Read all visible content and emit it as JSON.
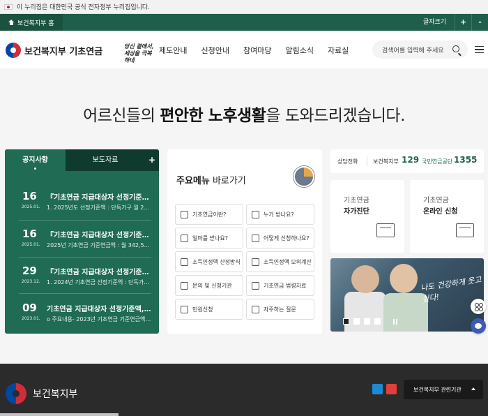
{
  "gov_banner": {
    "text": "이 누리집은 대한민국 공식 전자정부 누리집입니다."
  },
  "util": {
    "home_label": "보건복지부 홈",
    "fontsize_label": "글자크기",
    "plus": "+",
    "minus": "-"
  },
  "header": {
    "logo_text": "보건복지부 기초연금",
    "slogan": "당신 곁에서, 세상을 극복하네",
    "nav": [
      "제도안내",
      "신청안내",
      "참여마당",
      "알림소식",
      "자료실"
    ],
    "search_placeholder": "검색어를 입력해 주세요"
  },
  "hero": {
    "title_pre": "어르신들의 ",
    "title_bold": "편안한 노후생활",
    "title_post": "을 도와드리겠습니다."
  },
  "board": {
    "tabs": [
      "공지사항",
      "보도자료",
      "+"
    ],
    "notices": [
      {
        "day": "16",
        "ym": "2025.01.",
        "title": "『기초연금 지급대상자 선정기준액, ...",
        "summary": "1. 2025년도 선정기준액 : 단독가구 월 228..."
      },
      {
        "day": "16",
        "ym": "2025.01.",
        "title": "『기초연금 지급대상자 선정기준액, ...",
        "summary": "2025년 기초연금 기준연금액 : 월 342,51..."
      },
      {
        "day": "29",
        "ym": "2023.12.",
        "title": "『기초연금 지급대상자 선정기준액, ...",
        "summary": "1. 2024년 기초연금 선정기준액 : 단독가구 ..."
      },
      {
        "day": "09",
        "ym": "2023.01.",
        "title": "기초연금 지급대상자 선정기준액, ...",
        "summary": "o 주요내용- 2023년 기초연금 기준연금액 ..."
      }
    ]
  },
  "quick": {
    "title_bold": "주요메뉴",
    "title_rest": " 바로가기",
    "items": [
      "기초연금이란?",
      "누가 받나요?",
      "얼마를 받나요?",
      "어떻게 신청하나요?",
      "소득인정액 산정방식",
      "소득인정액 모의계산",
      "문의 및 신청기관",
      "기초연금 법령자료",
      "민원신청",
      "자주하는 질문"
    ]
  },
  "contact": {
    "label": "상담전화",
    "org1": "보건복지부",
    "num1": "129",
    "org2": "국민연금공단",
    "num2": "1355"
  },
  "cards": [
    {
      "line1": "기초연금",
      "line2": "자가진단"
    },
    {
      "line1": "기초연금",
      "line2": "온라인 신청"
    }
  ],
  "photo": {
    "slogan": "나도 건강하게 웃고 싶다!"
  },
  "footer": {
    "logo_text": "보건복지부",
    "related_label": "보건복지부 관련기관"
  }
}
